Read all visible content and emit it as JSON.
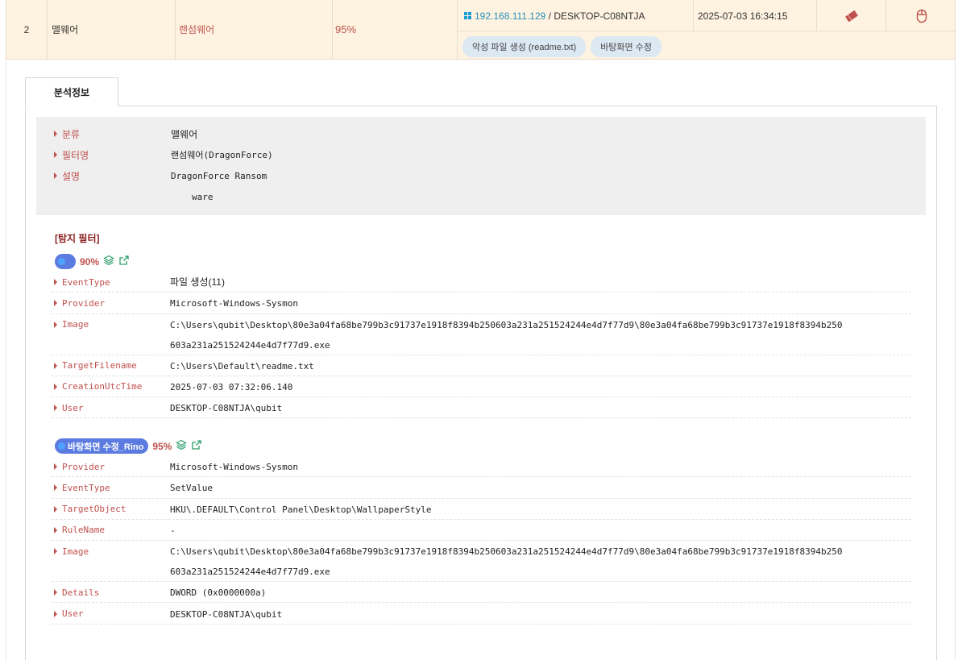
{
  "row": {
    "number": "2",
    "category": "맬웨어",
    "filter": "랜섬웨어",
    "score": "95%",
    "ip": "192.168.111.129",
    "separator": " / ",
    "hostname": "DESKTOP-C08NTJA",
    "timestamp": "2025-07-03 16:34:15",
    "tags": [
      "악성 파일 생성 (readme.txt)",
      "바탕화면 수정"
    ]
  },
  "tab": {
    "label": "분석정보"
  },
  "summary": {
    "items": [
      {
        "label": "분류",
        "value": "맬웨어"
      },
      {
        "label": "필터명",
        "value": "랜섬웨어(DragonForce)"
      },
      {
        "label": "설명",
        "value": "DragonForce Ransom",
        "value_cont": "ware"
      }
    ]
  },
  "detection": {
    "section_title": "[탐지 필터]",
    "filters": [
      {
        "name": "",
        "percent": "90%",
        "fields": [
          {
            "key": "EventType",
            "value": "파일 생성(11)"
          },
          {
            "key": "Provider",
            "value": "Microsoft-Windows-Sysmon"
          },
          {
            "key": "Image",
            "value": "C:\\Users\\qubit\\Desktop\\80e3a04fa68be799b3c91737e1918f8394b250603a231a251524244e4d7f77d9\\80e3a04fa68be799b3c91737e1918f8394b250",
            "value_cont": "603a231a251524244e4d7f77d9.exe"
          },
          {
            "key": "TargetFilename",
            "value": "C:\\Users\\Default\\readme.txt"
          },
          {
            "key": "CreationUtcTime",
            "value": "2025-07-03 07:32:06.140"
          },
          {
            "key": "User",
            "value": "DESKTOP-C08NTJA\\qubit"
          }
        ]
      },
      {
        "name": "바탕화면 수정_Rino",
        "percent": "95%",
        "fields": [
          {
            "key": "Provider",
            "value": "Microsoft-Windows-Sysmon"
          },
          {
            "key": "EventType",
            "value": "SetValue"
          },
          {
            "key": "TargetObject",
            "value": "HKU\\.DEFAULT\\Control Panel\\Desktop\\WallpaperStyle"
          },
          {
            "key": "RuleName",
            "value": "-"
          },
          {
            "key": "Image",
            "value": "C:\\Users\\qubit\\Desktop\\80e3a04fa68be799b3c91737e1918f8394b250603a231a251524244e4d7f77d9\\80e3a04fa68be799b3c91737e1918f8394b250",
            "value_cont": "603a231a251524244e4d7f77d9.exe"
          },
          {
            "key": "Details",
            "value": "DWORD (0x0000000a)"
          },
          {
            "key": "User",
            "value": "DESKTOP-C08NTJA\\qubit"
          }
        ]
      }
    ]
  },
  "colors": {
    "accent": "#c0504d",
    "pill": "#5b7be0",
    "link": "#2a8fb8",
    "row_bg": "#fdf3e0"
  }
}
